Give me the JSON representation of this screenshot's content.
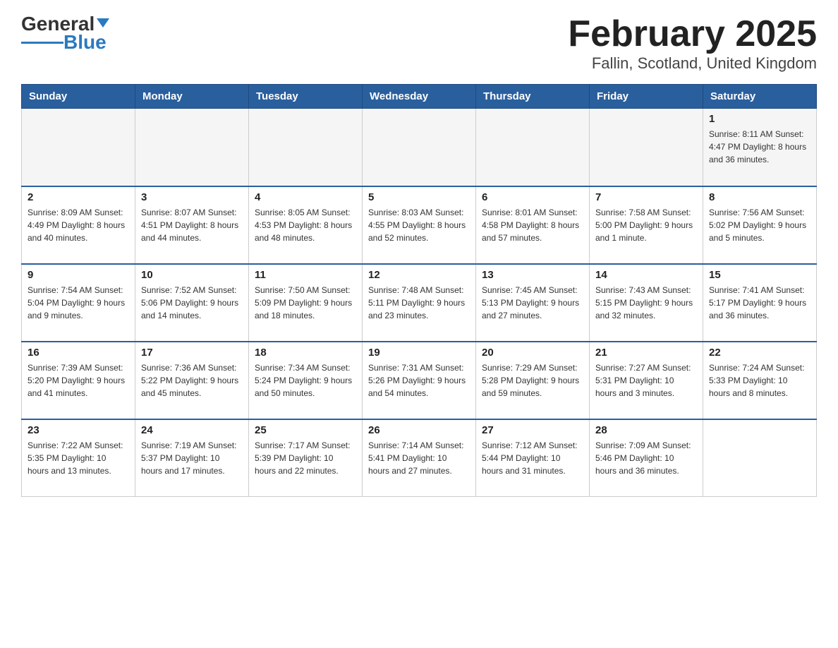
{
  "header": {
    "logo_text_general": "General",
    "logo_text_blue": "Blue",
    "title": "February 2025",
    "subtitle": "Fallin, Scotland, United Kingdom"
  },
  "weekdays": [
    "Sunday",
    "Monday",
    "Tuesday",
    "Wednesday",
    "Thursday",
    "Friday",
    "Saturday"
  ],
  "weeks": [
    [
      {
        "day": "",
        "info": ""
      },
      {
        "day": "",
        "info": ""
      },
      {
        "day": "",
        "info": ""
      },
      {
        "day": "",
        "info": ""
      },
      {
        "day": "",
        "info": ""
      },
      {
        "day": "",
        "info": ""
      },
      {
        "day": "1",
        "info": "Sunrise: 8:11 AM\nSunset: 4:47 PM\nDaylight: 8 hours\nand 36 minutes."
      }
    ],
    [
      {
        "day": "2",
        "info": "Sunrise: 8:09 AM\nSunset: 4:49 PM\nDaylight: 8 hours\nand 40 minutes."
      },
      {
        "day": "3",
        "info": "Sunrise: 8:07 AM\nSunset: 4:51 PM\nDaylight: 8 hours\nand 44 minutes."
      },
      {
        "day": "4",
        "info": "Sunrise: 8:05 AM\nSunset: 4:53 PM\nDaylight: 8 hours\nand 48 minutes."
      },
      {
        "day": "5",
        "info": "Sunrise: 8:03 AM\nSunset: 4:55 PM\nDaylight: 8 hours\nand 52 minutes."
      },
      {
        "day": "6",
        "info": "Sunrise: 8:01 AM\nSunset: 4:58 PM\nDaylight: 8 hours\nand 57 minutes."
      },
      {
        "day": "7",
        "info": "Sunrise: 7:58 AM\nSunset: 5:00 PM\nDaylight: 9 hours\nand 1 minute."
      },
      {
        "day": "8",
        "info": "Sunrise: 7:56 AM\nSunset: 5:02 PM\nDaylight: 9 hours\nand 5 minutes."
      }
    ],
    [
      {
        "day": "9",
        "info": "Sunrise: 7:54 AM\nSunset: 5:04 PM\nDaylight: 9 hours\nand 9 minutes."
      },
      {
        "day": "10",
        "info": "Sunrise: 7:52 AM\nSunset: 5:06 PM\nDaylight: 9 hours\nand 14 minutes."
      },
      {
        "day": "11",
        "info": "Sunrise: 7:50 AM\nSunset: 5:09 PM\nDaylight: 9 hours\nand 18 minutes."
      },
      {
        "day": "12",
        "info": "Sunrise: 7:48 AM\nSunset: 5:11 PM\nDaylight: 9 hours\nand 23 minutes."
      },
      {
        "day": "13",
        "info": "Sunrise: 7:45 AM\nSunset: 5:13 PM\nDaylight: 9 hours\nand 27 minutes."
      },
      {
        "day": "14",
        "info": "Sunrise: 7:43 AM\nSunset: 5:15 PM\nDaylight: 9 hours\nand 32 minutes."
      },
      {
        "day": "15",
        "info": "Sunrise: 7:41 AM\nSunset: 5:17 PM\nDaylight: 9 hours\nand 36 minutes."
      }
    ],
    [
      {
        "day": "16",
        "info": "Sunrise: 7:39 AM\nSunset: 5:20 PM\nDaylight: 9 hours\nand 41 minutes."
      },
      {
        "day": "17",
        "info": "Sunrise: 7:36 AM\nSunset: 5:22 PM\nDaylight: 9 hours\nand 45 minutes."
      },
      {
        "day": "18",
        "info": "Sunrise: 7:34 AM\nSunset: 5:24 PM\nDaylight: 9 hours\nand 50 minutes."
      },
      {
        "day": "19",
        "info": "Sunrise: 7:31 AM\nSunset: 5:26 PM\nDaylight: 9 hours\nand 54 minutes."
      },
      {
        "day": "20",
        "info": "Sunrise: 7:29 AM\nSunset: 5:28 PM\nDaylight: 9 hours\nand 59 minutes."
      },
      {
        "day": "21",
        "info": "Sunrise: 7:27 AM\nSunset: 5:31 PM\nDaylight: 10 hours\nand 3 minutes."
      },
      {
        "day": "22",
        "info": "Sunrise: 7:24 AM\nSunset: 5:33 PM\nDaylight: 10 hours\nand 8 minutes."
      }
    ],
    [
      {
        "day": "23",
        "info": "Sunrise: 7:22 AM\nSunset: 5:35 PM\nDaylight: 10 hours\nand 13 minutes."
      },
      {
        "day": "24",
        "info": "Sunrise: 7:19 AM\nSunset: 5:37 PM\nDaylight: 10 hours\nand 17 minutes."
      },
      {
        "day": "25",
        "info": "Sunrise: 7:17 AM\nSunset: 5:39 PM\nDaylight: 10 hours\nand 22 minutes."
      },
      {
        "day": "26",
        "info": "Sunrise: 7:14 AM\nSunset: 5:41 PM\nDaylight: 10 hours\nand 27 minutes."
      },
      {
        "day": "27",
        "info": "Sunrise: 7:12 AM\nSunset: 5:44 PM\nDaylight: 10 hours\nand 31 minutes."
      },
      {
        "day": "28",
        "info": "Sunrise: 7:09 AM\nSunset: 5:46 PM\nDaylight: 10 hours\nand 36 minutes."
      },
      {
        "day": "",
        "info": ""
      }
    ]
  ]
}
